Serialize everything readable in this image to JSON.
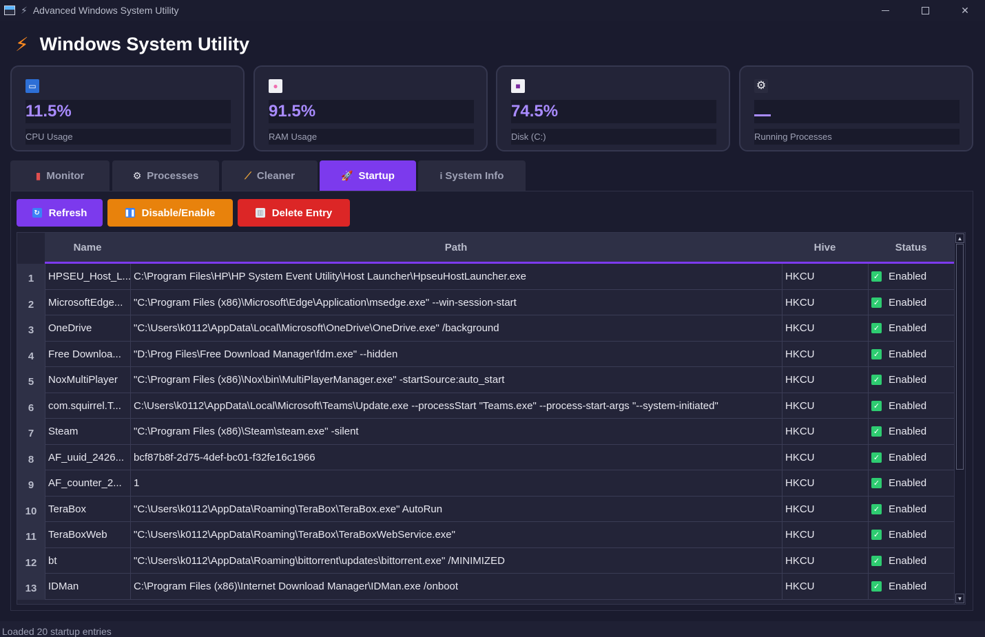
{
  "window": {
    "title": "Advanced Windows System Utility"
  },
  "header": {
    "title": "Windows System Utility",
    "icon": "lightning-icon"
  },
  "stats": [
    {
      "icon": "monitor-icon",
      "value": "11.5%",
      "label": "CPU Usage"
    },
    {
      "icon": "brain-icon",
      "value": "91.5%",
      "label": "RAM Usage"
    },
    {
      "icon": "floppy-disk-icon",
      "value": "74.5%",
      "label": "Disk (C:)"
    },
    {
      "icon": "gear-icon",
      "value": "",
      "label": "Running Processes"
    }
  ],
  "tabs": [
    {
      "label": "Monitor",
      "icon": "chart-icon"
    },
    {
      "label": "Processes",
      "icon": "gear-icon"
    },
    {
      "label": "Cleaner",
      "icon": "broom-icon"
    },
    {
      "label": "Startup",
      "icon": "rocket-icon",
      "active": true
    },
    {
      "label": "System Info",
      "icon": "info-icon"
    }
  ],
  "toolbar": {
    "refresh_label": "Refresh",
    "toggle_label": "Disable/Enable",
    "delete_label": "Delete Entry"
  },
  "colors": {
    "accent": "#7c3aed",
    "refresh": "#7c3aed",
    "toggle": "#e8820c",
    "delete": "#dc2626",
    "enabled": "#2ecc71"
  },
  "table": {
    "columns": [
      "Name",
      "Path",
      "Hive",
      "Status"
    ],
    "rows": [
      {
        "num": "1",
        "name": "HPSEU_Host_L...",
        "path": "C:\\Program Files\\HP\\HP System Event Utility\\Host Launcher\\HpseuHostLauncher.exe",
        "hive": "HKCU",
        "status": "Enabled"
      },
      {
        "num": "2",
        "name": "MicrosoftEdge...",
        "path": "\"C:\\Program Files (x86)\\Microsoft\\Edge\\Application\\msedge.exe\" --win-session-start",
        "hive": "HKCU",
        "status": "Enabled"
      },
      {
        "num": "3",
        "name": "OneDrive",
        "path": "\"C:\\Users\\k0112\\AppData\\Local\\Microsoft\\OneDrive\\OneDrive.exe\" /background",
        "hive": "HKCU",
        "status": "Enabled"
      },
      {
        "num": "4",
        "name": "Free Downloa...",
        "path": "\"D:\\Prog Files\\Free Download Manager\\fdm.exe\" --hidden",
        "hive": "HKCU",
        "status": "Enabled"
      },
      {
        "num": "5",
        "name": "NoxMultiPlayer",
        "path": "\"C:\\Program Files (x86)\\Nox\\bin\\MultiPlayerManager.exe\" -startSource:auto_start",
        "hive": "HKCU",
        "status": "Enabled"
      },
      {
        "num": "6",
        "name": "com.squirrel.T...",
        "path": "C:\\Users\\k0112\\AppData\\Local\\Microsoft\\Teams\\Update.exe --processStart \"Teams.exe\" --process-start-args \"--system-initiated\"",
        "hive": "HKCU",
        "status": "Enabled"
      },
      {
        "num": "7",
        "name": "Steam",
        "path": "\"C:\\Program Files (x86)\\Steam\\steam.exe\" -silent",
        "hive": "HKCU",
        "status": "Enabled"
      },
      {
        "num": "8",
        "name": "AF_uuid_2426...",
        "path": "bcf87b8f-2d75-4def-bc01-f32fe16c1966",
        "hive": "HKCU",
        "status": "Enabled"
      },
      {
        "num": "9",
        "name": "AF_counter_2...",
        "path": "1",
        "hive": "HKCU",
        "status": "Enabled"
      },
      {
        "num": "10",
        "name": "TeraBox",
        "path": "\"C:\\Users\\k0112\\AppData\\Roaming\\TeraBox\\TeraBox.exe\" AutoRun",
        "hive": "HKCU",
        "status": "Enabled"
      },
      {
        "num": "11",
        "name": "TeraBoxWeb",
        "path": "\"C:\\Users\\k0112\\AppData\\Roaming\\TeraBox\\TeraBoxWebService.exe\"",
        "hive": "HKCU",
        "status": "Enabled"
      },
      {
        "num": "12",
        "name": "bt",
        "path": "\"C:\\Users\\k0112\\AppData\\Roaming\\bittorrent\\updates\\bittorrent.exe\"  /MINIMIZED",
        "hive": "HKCU",
        "status": "Enabled"
      },
      {
        "num": "13",
        "name": "IDMan",
        "path": "C:\\Program Files (x86)\\Internet Download Manager\\IDMan.exe /onboot",
        "hive": "HKCU",
        "status": "Enabled"
      }
    ]
  },
  "status_bar": {
    "text": "Loaded 20 startup entries"
  }
}
